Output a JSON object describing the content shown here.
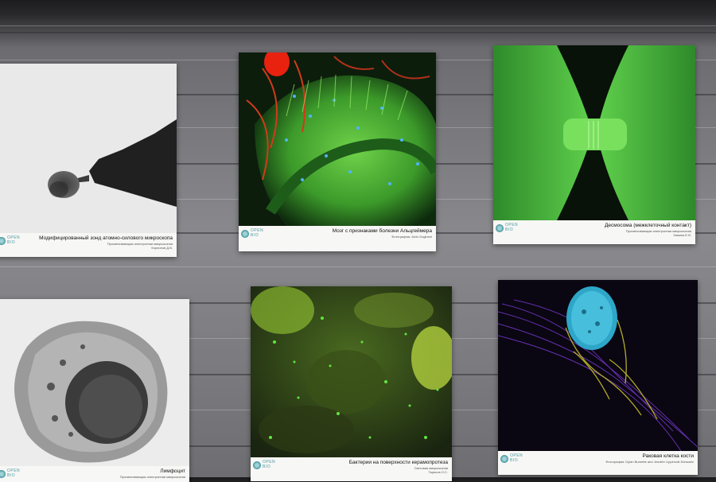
{
  "wall": {
    "background": "#7c7c80"
  },
  "panels": [
    {
      "title": "Модифицированный зонд атомно-силового микроскопа",
      "technique": "Просвечивающая электронная микроскопия",
      "author": "Корнилов Д.В.",
      "logo_top": "OPEN",
      "logo_bottom": "BIO"
    },
    {
      "title": "Мозг с признаками болезни Альцгеймера",
      "technique": "Фотография: Alvin Gogineni",
      "author": "",
      "logo_top": "OPEN",
      "logo_bottom": "BIO"
    },
    {
      "title": "Десмосома (межклеточный контакт)",
      "technique": "Просвечивающая электронная микроскопия",
      "author": "Зимина Е.В.",
      "logo_top": "OPEN",
      "logo_bottom": "BIO"
    },
    {
      "title": "Лимфоцит",
      "technique": "Просвечивающая электронная микроскопия",
      "author": "",
      "logo_top": "OPEN",
      "logo_bottom": "BIO"
    },
    {
      "title": "Бактерии на поверхности керамопротеза",
      "technique": "Световая микроскопия",
      "author": "Тарасов О.С.",
      "logo_top": "OPEN",
      "logo_bottom": "BIO"
    },
    {
      "title": "Раковая клетка кости",
      "technique": "Фотография: Dylan Burnette and Jennifer Lippincott-Schwartz",
      "author": "",
      "logo_top": "OPEN",
      "logo_bottom": "BIO"
    }
  ]
}
